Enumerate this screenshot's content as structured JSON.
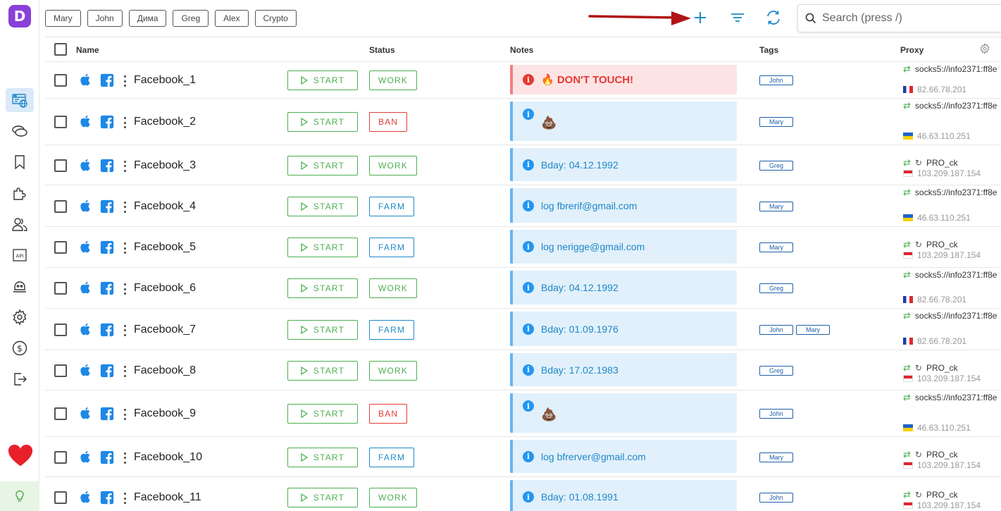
{
  "app": {
    "logo_letter": "D"
  },
  "filter_tags": [
    "Mary",
    "John",
    "Дима",
    "Greg",
    "Alex",
    "Crypto"
  ],
  "search": {
    "placeholder": "Search (press /)"
  },
  "sidebar": {
    "items": [
      "browser-profiles-icon",
      "cookies-icon",
      "bookmark-icon",
      "extensions-icon",
      "team-icon",
      "api-icon",
      "robot-icon",
      "settings-icon",
      "billing-icon",
      "logout-icon"
    ],
    "favorite_icon": "heart-icon",
    "tip_icon": "lightbulb-icon"
  },
  "table": {
    "headers": {
      "name": "Name",
      "status": "Status",
      "notes": "Notes",
      "tags": "Tags",
      "proxy": "Proxy"
    },
    "start_label": "START",
    "rows": [
      {
        "name": "Facebook_1",
        "status": "WORK",
        "note": "🔥 DON'T TOUCH!",
        "note_type": "danger",
        "tags": [
          "John"
        ],
        "proxy_type": "socks5://info2371:ff8e",
        "proxy_ip": "82.66.78.201",
        "flag": "fr"
      },
      {
        "name": "Facebook_2",
        "status": "BAN",
        "note": "💩",
        "note_type": "info",
        "tags": [
          "Mary"
        ],
        "proxy_type": "socks5://info2371:ff8e",
        "proxy_ip": "46.63.110.251",
        "flag": "ua"
      },
      {
        "name": "Facebook_3",
        "status": "WORK",
        "note": "Bday: 04.12.1992",
        "note_type": "info",
        "tags": [
          "Greg"
        ],
        "proxy_type": "PRO_ck",
        "proxy_ip": "103.209.187.154",
        "flag": "id"
      },
      {
        "name": "Facebook_4",
        "status": "FARM",
        "note": "log fbrerif@gmail.com",
        "note_type": "info",
        "tags": [
          "Mary"
        ],
        "proxy_type": "socks5://info2371:ff8e",
        "proxy_ip": "46.63.110.251",
        "flag": "ua"
      },
      {
        "name": "Facebook_5",
        "status": "FARM",
        "note": "log nerigge@gmail.com",
        "note_type": "info",
        "tags": [
          "Mary"
        ],
        "proxy_type": "PRO_ck",
        "proxy_ip": "103.209.187.154",
        "flag": "id"
      },
      {
        "name": "Facebook_6",
        "status": "WORK",
        "note": "Bday: 04.12.1992",
        "note_type": "info",
        "tags": [
          "Greg"
        ],
        "proxy_type": "socks5://info2371:ff8e",
        "proxy_ip": "82.66.78.201",
        "flag": "fr"
      },
      {
        "name": "Facebook_7",
        "status": "FARM",
        "note": "Bday: 01.09.1976",
        "note_type": "info",
        "tags": [
          "John",
          "Mary"
        ],
        "proxy_type": "socks5://info2371:ff8e",
        "proxy_ip": "82.66.78.201",
        "flag": "fr"
      },
      {
        "name": "Facebook_8",
        "status": "WORK",
        "note": "Bday: 17.02.1983",
        "note_type": "info",
        "tags": [
          "Greg"
        ],
        "proxy_type": "PRO_ck",
        "proxy_ip": "103.209.187.154",
        "flag": "id"
      },
      {
        "name": "Facebook_9",
        "status": "BAN",
        "note": "💩",
        "note_type": "info",
        "tags": [
          "John"
        ],
        "proxy_type": "socks5://info2371:ff8e",
        "proxy_ip": "46.63.110.251",
        "flag": "ua"
      },
      {
        "name": "Facebook_10",
        "status": "FARM",
        "note": "log bfrerver@gmail.com",
        "note_type": "info",
        "tags": [
          "Mary"
        ],
        "proxy_type": "PRO_ck",
        "proxy_ip": "103.209.187.154",
        "flag": "id"
      },
      {
        "name": "Facebook_11",
        "status": "WORK",
        "note": "Bday: 01.08.1991",
        "note_type": "info",
        "tags": [
          "John"
        ],
        "proxy_type": "PRO_ck",
        "proxy_ip": "103.209.187.154",
        "flag": "id"
      }
    ]
  },
  "colors": {
    "accent": "#2196f3",
    "brand": "#8b3fd9",
    "work": "#4caf50",
    "ban": "#e53935",
    "farm": "#1e88c8",
    "arrow": "#b01515"
  }
}
